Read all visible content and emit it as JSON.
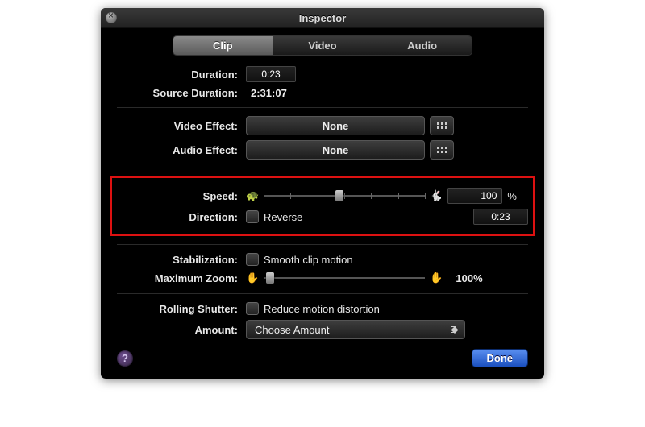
{
  "window": {
    "title": "Inspector"
  },
  "tabs": {
    "items": [
      "Clip",
      "Video",
      "Audio"
    ],
    "selected": "Clip"
  },
  "duration": {
    "label": "Duration:",
    "value": "0:23"
  },
  "source_duration": {
    "label": "Source Duration:",
    "value": "2:31:07"
  },
  "video_effect": {
    "label": "Video Effect:",
    "value": "None"
  },
  "audio_effect": {
    "label": "Audio Effect:",
    "value": "None"
  },
  "speed": {
    "label": "Speed:",
    "value": "100",
    "unit": "%",
    "slider_pct": 47
  },
  "direction": {
    "label": "Direction:",
    "checkbox_label": "Reverse",
    "time": "0:23"
  },
  "stabilization": {
    "label": "Stabilization:",
    "checkbox_label": "Smooth clip motion"
  },
  "max_zoom": {
    "label": "Maximum Zoom:",
    "value": "100%",
    "slider_pct": 4
  },
  "rolling_shutter": {
    "label": "Rolling Shutter:",
    "checkbox_label": "Reduce motion distortion"
  },
  "amount": {
    "label": "Amount:",
    "value": "Choose Amount"
  },
  "footer": {
    "done": "Done",
    "help": "?"
  },
  "icons": {
    "turtle": "🐢",
    "rabbit": "🐇",
    "hand": "✋"
  }
}
